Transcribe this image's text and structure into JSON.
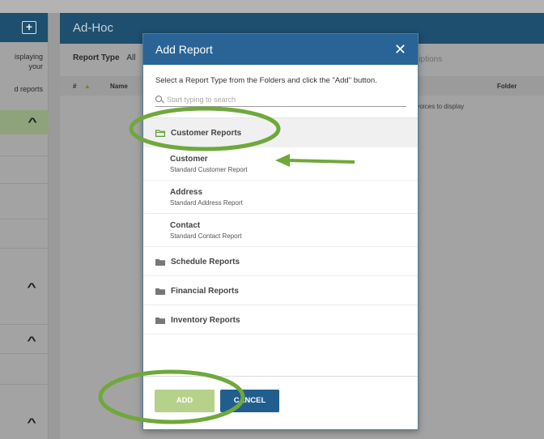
{
  "left_panel": {
    "add_label": "+",
    "text_1": "isplaying",
    "text_2": "your",
    "text_3": "d reports"
  },
  "main": {
    "title": "Ad-Hoc",
    "report_type_label": "Report Type",
    "report_type_value": "All",
    "descriptions_placeholder": "riptions",
    "table_headers": {
      "num": "#",
      "name": "Name",
      "folder": "Folder"
    },
    "empty_message": "nvoices to display"
  },
  "modal": {
    "title": "Add Report",
    "close_glyph": "✕",
    "instruction": "Select a Report Type from the Folders and click the \"Add\" button.",
    "search_placeholder": "Start typing to search",
    "open_folder": {
      "label": "Customer Reports",
      "items": [
        {
          "name": "Customer",
          "description": "Standard Customer Report"
        },
        {
          "name": "Address",
          "description": "Standard Address Report"
        },
        {
          "name": "Contact",
          "description": "Standard Contact Report"
        }
      ]
    },
    "closed_folders": [
      {
        "label": "Schedule Reports"
      },
      {
        "label": "Financial Reports"
      },
      {
        "label": "Inventory Reports"
      }
    ],
    "add_button": "ADD",
    "cancel_button": "CANCEL"
  },
  "colors": {
    "header_blue": "#2a6496",
    "add_button_green": "#b6d18a",
    "cancel_button_blue": "#215e8e",
    "annotation_green": "#6fa83b",
    "open_folder_icon": "#5a9a2f",
    "closed_folder_icon": "#777777"
  },
  "icons": {
    "close": "close-icon",
    "search": "search-icon",
    "folder_open": "folder-open-icon",
    "folder": "folder-icon",
    "chevron": "chevron-up-icon"
  }
}
